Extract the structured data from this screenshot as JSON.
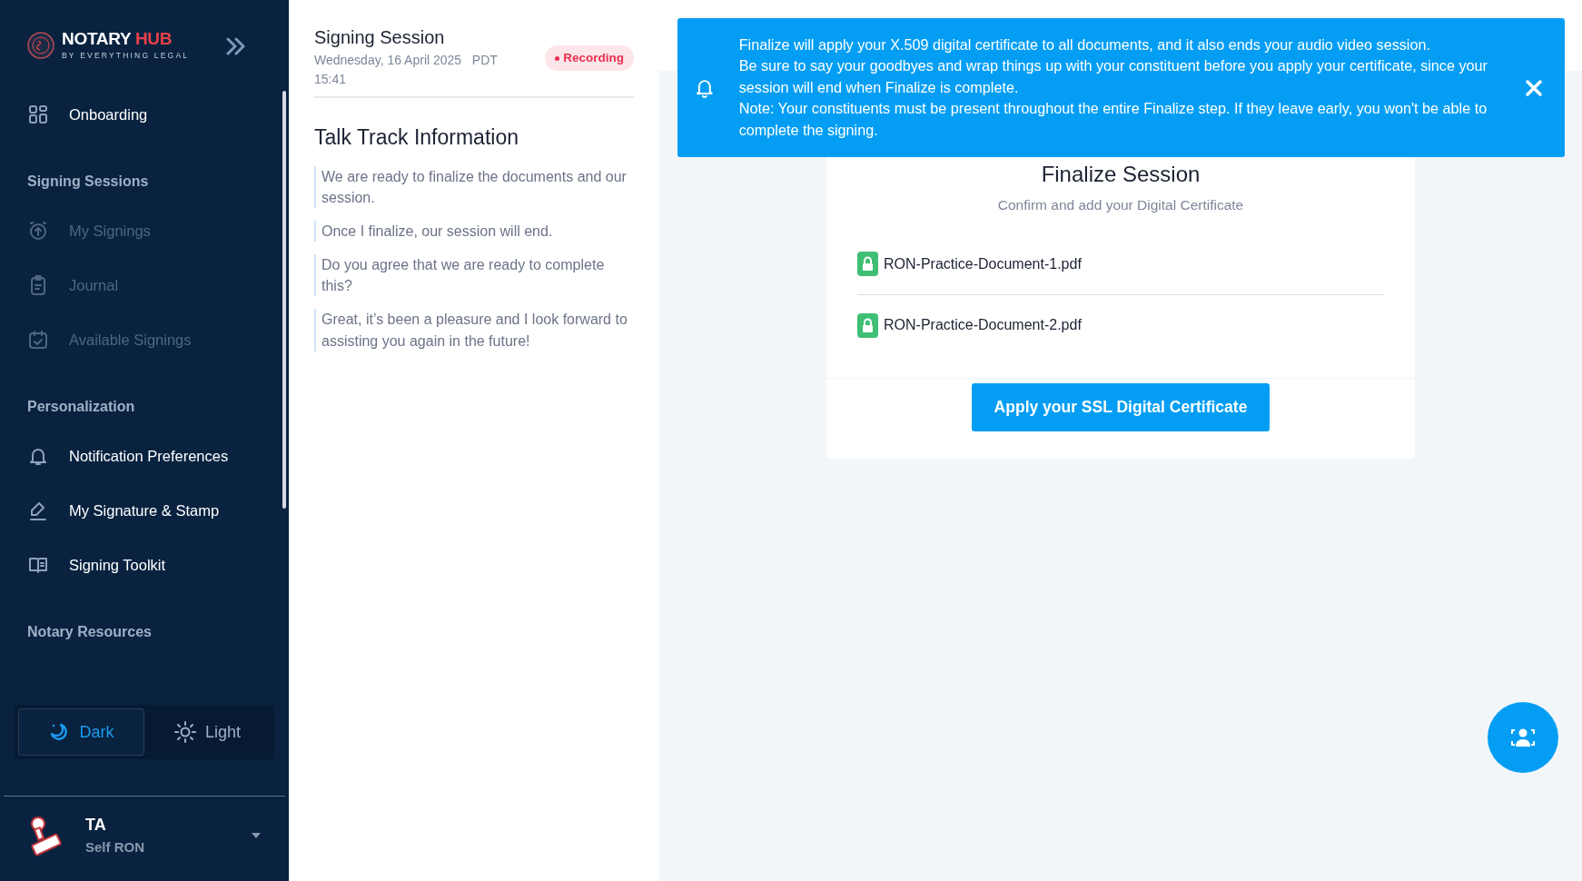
{
  "brand": {
    "name": "NOTARY",
    "accent": "HUB",
    "tagline": "BY EVERYTHING LEGAL"
  },
  "sidebar": {
    "sections": [
      {
        "items": [
          {
            "label": "Onboarding",
            "disabled": false
          }
        ]
      },
      {
        "title": "Signing Sessions",
        "items": [
          {
            "label": "My Signings",
            "disabled": true
          },
          {
            "label": "Journal",
            "disabled": true
          },
          {
            "label": "Available Signings",
            "disabled": true
          }
        ]
      },
      {
        "title": "Personalization",
        "items": [
          {
            "label": "Notification Preferences",
            "disabled": false
          },
          {
            "label": "My Signature & Stamp",
            "disabled": false
          },
          {
            "label": "Signing Toolkit",
            "disabled": false
          }
        ]
      },
      {
        "title": "Notary Resources"
      }
    ],
    "theme_toggle": [
      {
        "label": "Dark",
        "selected": true
      },
      {
        "label": "Light",
        "selected": false
      }
    ],
    "user": {
      "name": "TA",
      "role": "Self RON"
    }
  },
  "session": {
    "title": "Signing Session",
    "date": "Wednesday, 16 April 2025",
    "zone": "PDT",
    "time": "15:41",
    "badge": "Recording"
  },
  "talk_track": {
    "title": "Talk Track Information",
    "lines": [
      "We are ready to finalize the documents and our session.",
      "Once I finalize, our session will end.",
      "Do you agree that we are ready to complete this?",
      "Great, it’s been a pleasure and I look forward to assisting you again in the future!"
    ]
  },
  "toast": {
    "lines": [
      "Finalize will apply your X.509 digital certificate to all documents, and it also ends your audio video session.",
      "Be sure to say your goodbyes and wrap things up with your constituent before you apply your certificate, since your session will end when Finalize is complete.",
      "Note: Your constituents must be present throughout the entire Finalize step. If they leave early, you won't be able to complete the signing."
    ]
  },
  "finalize": {
    "title": "Finalize Session",
    "subtitle": "Confirm and add your Digital Certificate",
    "documents": [
      "RON-Practice-Document-1.pdf",
      "RON-Practice-Document-2.pdf"
    ],
    "button": "Apply your SSL Digital Certificate"
  }
}
